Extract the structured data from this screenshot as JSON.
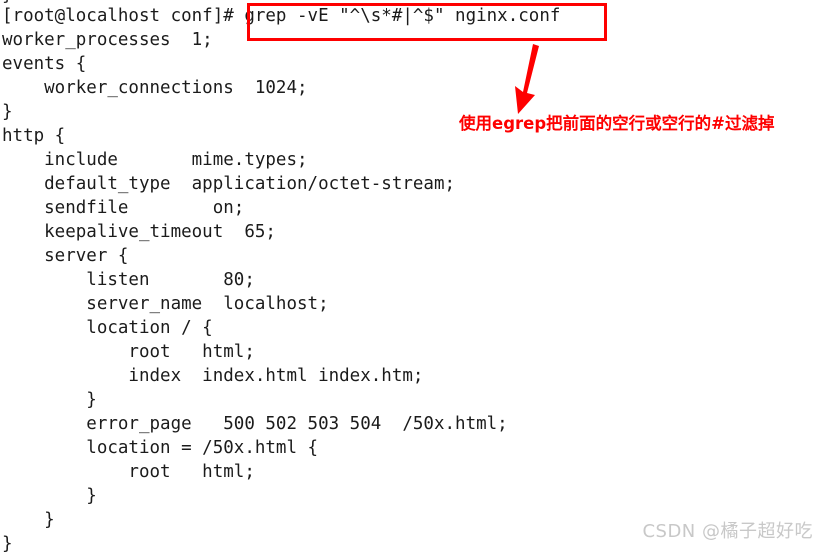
{
  "terminal": {
    "cut_top_glyph": "}",
    "prompt": "[root@localhost conf]#",
    "command": "grep -vE \"^\\s*#|^$\" nginx.conf",
    "prompt_line_full": "[root@localhost conf]# grep -vE \"^\\s*#|^$\" nginx.conf",
    "output_lines": [
      "worker_processes  1;",
      "events {",
      "    worker_connections  1024;",
      "}",
      "http {",
      "    include       mime.types;",
      "    default_type  application/octet-stream;",
      "    sendfile        on;",
      "    keepalive_timeout  65;",
      "    server {",
      "        listen       80;",
      "        server_name  localhost;",
      "        location / {",
      "            root   html;",
      "            index  index.html index.htm;",
      "        }",
      "        error_page   500 502 503 504  /50x.html;",
      "        location = /50x.html {",
      "            root   html;",
      "        }",
      "    }",
      "}"
    ]
  },
  "annotation": {
    "text": "使用egrep把前面的空行或空行的#过滤掉",
    "color": "#fe0000",
    "arrow_name": "down-left-arrow",
    "box_color": "#fe0000"
  },
  "watermark": {
    "text": "CSDN @橘子超好吃",
    "color": "#c8c8c8"
  }
}
